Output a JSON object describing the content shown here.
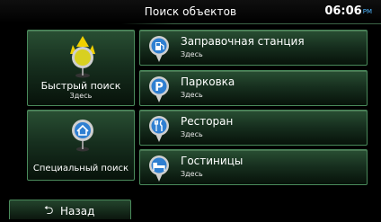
{
  "header": {
    "title": "Поиск объектов",
    "time": "06:06",
    "ampm": "PM"
  },
  "quick_search": {
    "label": "Быстрый поиск",
    "sublabel": "Здесь"
  },
  "special_search": {
    "label": "Специальный поиск"
  },
  "categories": [
    {
      "title": "Заправочная станция",
      "subtitle": "Здесь",
      "icon": "gas-station-icon"
    },
    {
      "title": "Парковка",
      "subtitle": "Здесь",
      "icon": "parking-icon"
    },
    {
      "title": "Ресторан",
      "subtitle": "Здесь",
      "icon": "restaurant-icon"
    },
    {
      "title": "Гостиницы",
      "subtitle": "Здесь",
      "icon": "hotel-icon"
    }
  ],
  "back": {
    "label": "Назад"
  },
  "colors": {
    "accent": "#4a8a5b",
    "pin": "#2f7fd1"
  }
}
